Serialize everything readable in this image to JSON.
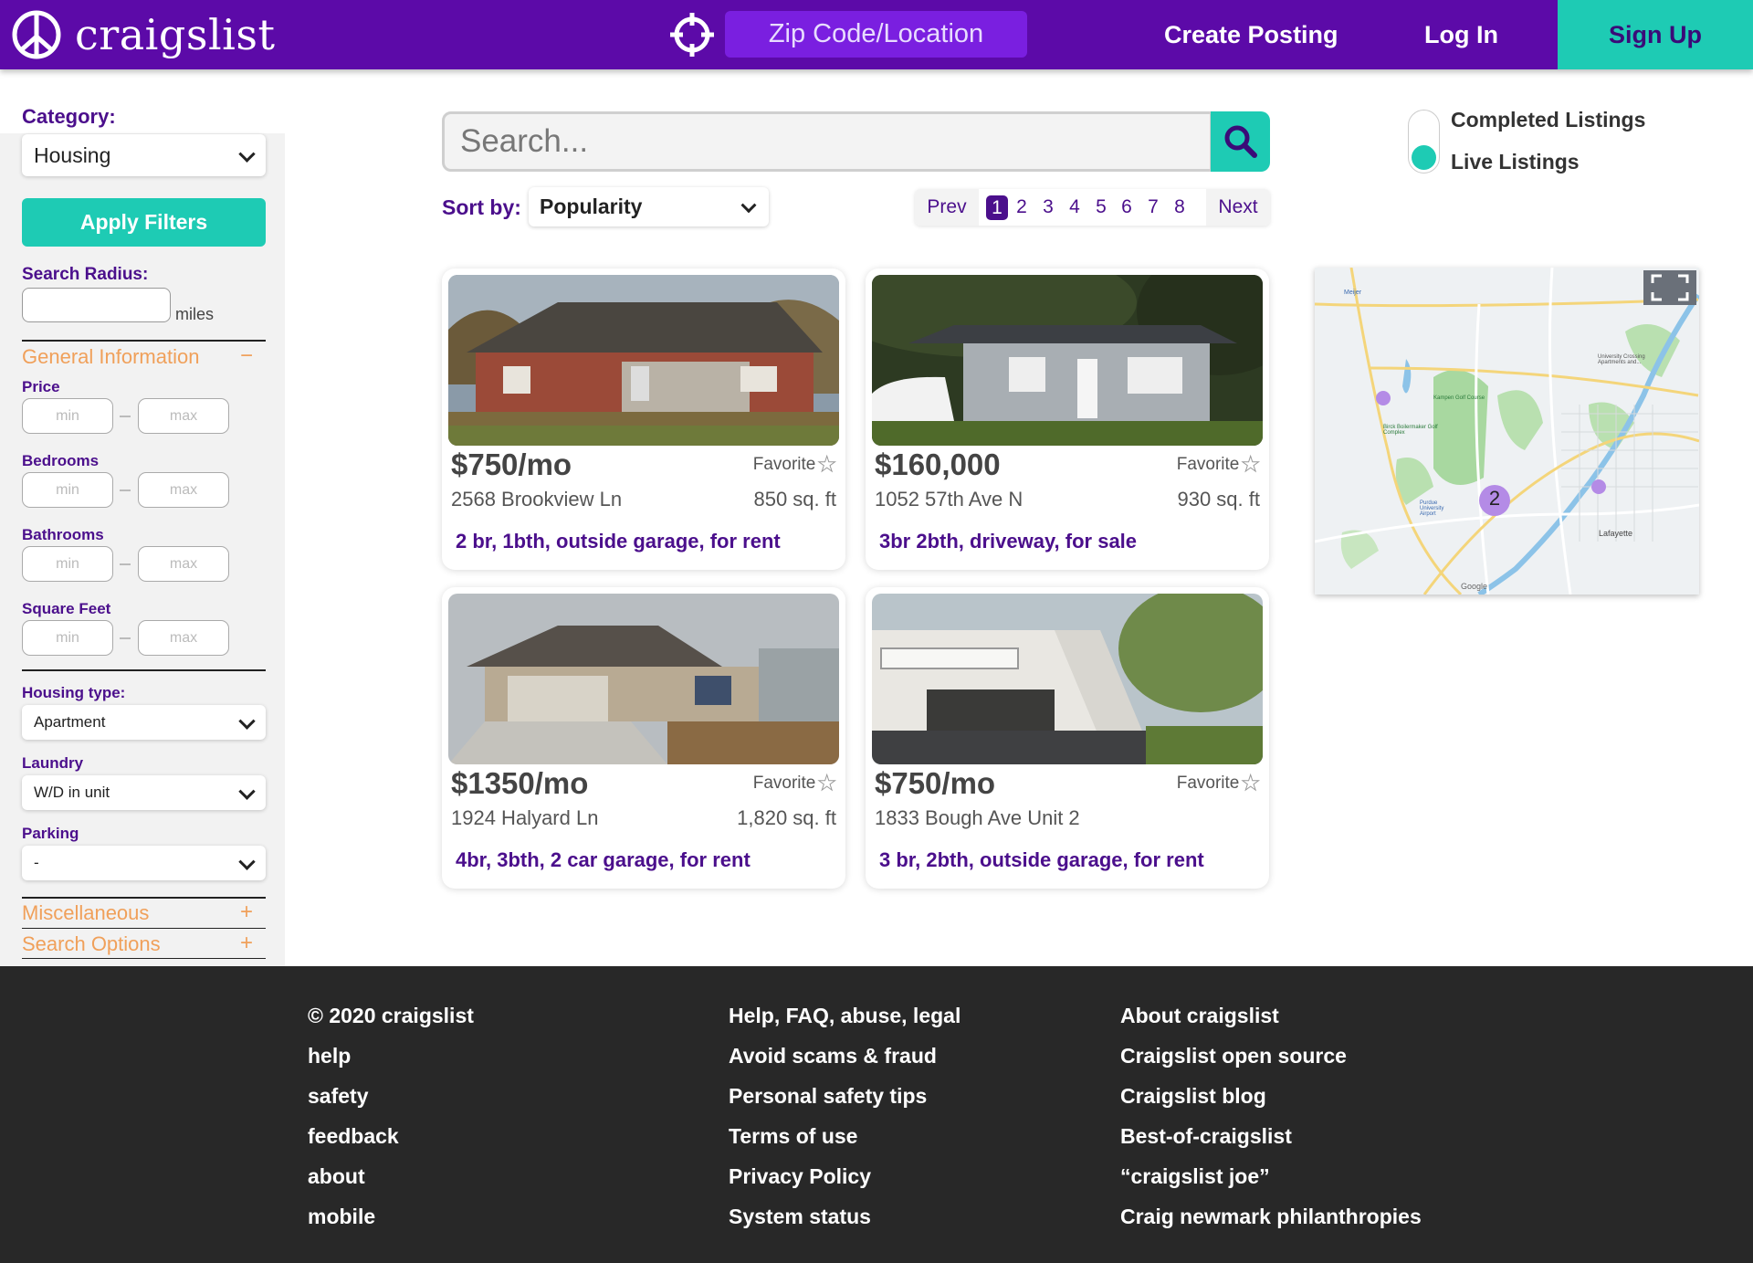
{
  "header": {
    "logo_text": "craigslist",
    "location_placeholder": "Zip Code/Location",
    "create_posting": "Create Posting",
    "log_in": "Log In",
    "sign_up": "Sign Up",
    "colors": {
      "bar": "#5c0aa8",
      "accent": "#1ecbb4"
    }
  },
  "sidebar": {
    "category_label": "Category:",
    "category_value": "Housing",
    "apply_filters": "Apply Filters",
    "search_radius_label": "Search Radius:",
    "search_radius_value": "",
    "miles": "miles",
    "general_information": "General Information",
    "general_sign": "−",
    "ranges": [
      {
        "label": "Price",
        "min": "min",
        "max": "max"
      },
      {
        "label": "Bedrooms",
        "min": "min",
        "max": "max"
      },
      {
        "label": "Bathrooms",
        "min": "min",
        "max": "max"
      },
      {
        "label": "Square Feet",
        "min": "min",
        "max": "max"
      }
    ],
    "housing_type_label": "Housing type:",
    "housing_type_value": "Apartment",
    "laundry_label": "Laundry",
    "laundry_value": "W/D in unit",
    "parking_label": "Parking",
    "parking_value": "-",
    "miscellaneous": "Miscellaneous",
    "search_options": "Search Options",
    "plus": "+"
  },
  "main": {
    "search_placeholder": "Search...",
    "sort_label": "Sort by:",
    "sort_value": "Popularity",
    "pager": {
      "prev": "Prev",
      "next": "Next",
      "pages": [
        "1",
        "2",
        "3",
        "4",
        "5",
        "6",
        "7",
        "8"
      ],
      "current": "1"
    },
    "toggle": {
      "completed": "Completed Listings",
      "live": "Live Listings",
      "selected": "Live Listings"
    }
  },
  "listings": [
    {
      "price": "$750/mo",
      "favorite": "Favorite",
      "address": "2568 Brookview Ln",
      "sqft": "850 sq. ft",
      "desc": "2 br, 1bth, outside garage, for rent"
    },
    {
      "price": "$160,000",
      "favorite": "Favorite",
      "address": "1052 57th Ave N",
      "sqft": "930 sq. ft",
      "desc": "3br 2bth, driveway, for sale"
    },
    {
      "price": "$1350/mo",
      "favorite": "Favorite",
      "address": "1924 Halyard Ln",
      "sqft": "1,820 sq. ft",
      "desc": "4br, 3bth, 2 car garage, for rent"
    },
    {
      "price": "$750/mo",
      "favorite": "Favorite",
      "address": "1833 Bough Ave Unit 2",
      "sqft": "",
      "desc": "3 br, 2bth, outside garage, for rent"
    }
  ],
  "map": {
    "cluster_count": "2",
    "labels": [
      "Meijer",
      "University Crossing Apartments and...",
      "Kampen Golf Course",
      "Birck Boilermaker Golf Complex",
      "Purdue University Airport",
      "Lafayette",
      "Google"
    ]
  },
  "footer": {
    "col1": [
      "© 2020 craigslist",
      "help",
      "safety",
      "feedback",
      "about",
      "mobile"
    ],
    "col2": [
      "Help, FAQ, abuse, legal",
      "Avoid scams & fraud",
      "Personal safety tips",
      "Terms of use",
      "Privacy Policy",
      "System status"
    ],
    "col3": [
      "About craigslist",
      "Craigslist open source",
      "Craigslist blog",
      "Best-of-craigslist",
      "“craigslist joe”",
      "Craig newmark philanthropies"
    ]
  }
}
